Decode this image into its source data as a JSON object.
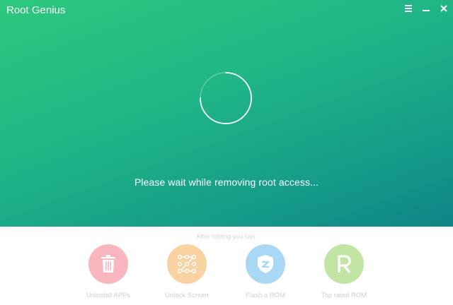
{
  "window": {
    "title": "Root Genius",
    "controls": [
      "menu-icon",
      "minimize-icon",
      "close-icon"
    ]
  },
  "main": {
    "status_text": "Please wait while removing root access..."
  },
  "footer": {
    "heading": "After rooting you can:",
    "features": [
      {
        "label": "Uninstall APPs",
        "icon": "trash-icon",
        "color": "#f9b6bf"
      },
      {
        "label": "Unlock Screen",
        "icon": "pattern-lock-icon",
        "color": "#f8d2a0"
      },
      {
        "label": "Flash a ROM",
        "icon": "shield-icon",
        "color": "#a9d8f5"
      },
      {
        "label": "Top rated ROM",
        "icon": "r-letter-icon",
        "color": "#c3e5a4"
      }
    ]
  },
  "colors": {
    "gradient_start": "#2cc97d",
    "gradient_end": "#0e8487"
  }
}
